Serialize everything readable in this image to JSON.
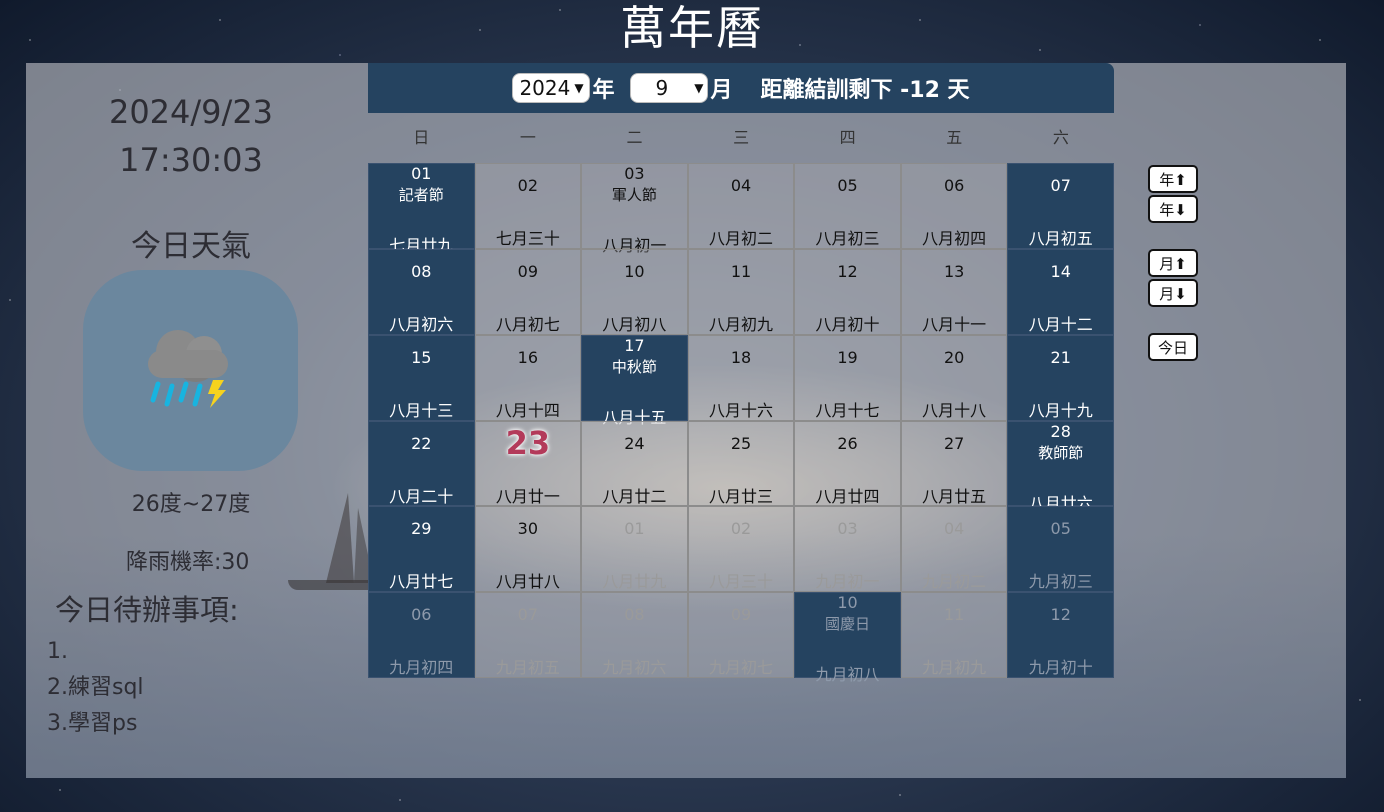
{
  "page_title": "萬年曆",
  "left": {
    "date": "2024/9/23",
    "time": "17:30:03",
    "weather_title": "今日天氣",
    "weather_icon": "thunderstorm-rain-icon",
    "temperature": "26度~27度",
    "rain_chance": "降雨機率:30",
    "todo_title": "今日待辦事項:",
    "todos": [
      "1.",
      "2.練習sql",
      "3.學習ps"
    ]
  },
  "header": {
    "year_value": "2024",
    "year_label": "年",
    "month_value": "9",
    "month_label": "月",
    "countdown": "距離結訓剩下 -12 天"
  },
  "weekdays": [
    "日",
    "一",
    "二",
    "三",
    "四",
    "五",
    "六"
  ],
  "calendar": [
    [
      {
        "day": "01",
        "fest": "記者節",
        "lunar": "七月廿九",
        "type": "weekend"
      },
      {
        "day": "02",
        "lunar": "七月三十",
        "type": "normal"
      },
      {
        "day": "03",
        "fest": "軍人節",
        "lunar": "八月初一",
        "type": "normal"
      },
      {
        "day": "04",
        "lunar": "八月初二",
        "type": "normal"
      },
      {
        "day": "05",
        "lunar": "八月初三",
        "type": "normal"
      },
      {
        "day": "06",
        "lunar": "八月初四",
        "type": "normal"
      },
      {
        "day": "07",
        "lunar": "八月初五",
        "type": "weekend"
      }
    ],
    [
      {
        "day": "08",
        "lunar": "八月初六",
        "type": "weekend"
      },
      {
        "day": "09",
        "lunar": "八月初七",
        "type": "normal"
      },
      {
        "day": "10",
        "lunar": "八月初八",
        "type": "normal"
      },
      {
        "day": "11",
        "lunar": "八月初九",
        "type": "normal"
      },
      {
        "day": "12",
        "lunar": "八月初十",
        "type": "normal"
      },
      {
        "day": "13",
        "lunar": "八月十一",
        "type": "normal"
      },
      {
        "day": "14",
        "lunar": "八月十二",
        "type": "weekend"
      }
    ],
    [
      {
        "day": "15",
        "lunar": "八月十三",
        "type": "weekend"
      },
      {
        "day": "16",
        "lunar": "八月十四",
        "type": "normal"
      },
      {
        "day": "17",
        "fest": "中秋節",
        "lunar": "八月十五",
        "type": "holiday"
      },
      {
        "day": "18",
        "lunar": "八月十六",
        "type": "normal"
      },
      {
        "day": "19",
        "lunar": "八月十七",
        "type": "normal"
      },
      {
        "day": "20",
        "lunar": "八月十八",
        "type": "normal"
      },
      {
        "day": "21",
        "lunar": "八月十九",
        "type": "weekend"
      }
    ],
    [
      {
        "day": "22",
        "lunar": "八月二十",
        "type": "weekend"
      },
      {
        "day": "23",
        "lunar": "八月廿一",
        "type": "today"
      },
      {
        "day": "24",
        "lunar": "八月廿二",
        "type": "normal"
      },
      {
        "day": "25",
        "lunar": "八月廿三",
        "type": "normal"
      },
      {
        "day": "26",
        "lunar": "八月廿四",
        "type": "normal"
      },
      {
        "day": "27",
        "lunar": "八月廿五",
        "type": "normal"
      },
      {
        "day": "28",
        "fest": "教師節",
        "lunar": "八月廿六",
        "type": "weekend"
      }
    ],
    [
      {
        "day": "29",
        "lunar": "八月廿七",
        "type": "weekend"
      },
      {
        "day": "30",
        "lunar": "八月廿八",
        "type": "normal"
      },
      {
        "day": "01",
        "lunar": "八月廿九",
        "type": "other"
      },
      {
        "day": "02",
        "lunar": "八月三十",
        "type": "other"
      },
      {
        "day": "03",
        "lunar": "九月初一",
        "type": "other"
      },
      {
        "day": "04",
        "lunar": "九月初二",
        "type": "other"
      },
      {
        "day": "05",
        "lunar": "九月初三",
        "type": "other weekend"
      }
    ],
    [
      {
        "day": "06",
        "lunar": "九月初四",
        "type": "other weekend"
      },
      {
        "day": "07",
        "lunar": "九月初五",
        "type": "other"
      },
      {
        "day": "08",
        "lunar": "九月初六",
        "type": "other"
      },
      {
        "day": "09",
        "lunar": "九月初七",
        "type": "other"
      },
      {
        "day": "10",
        "fest": "國慶日",
        "lunar": "九月初八",
        "type": "other holiday"
      },
      {
        "day": "11",
        "lunar": "九月初九",
        "type": "other"
      },
      {
        "day": "12",
        "lunar": "九月初十",
        "type": "other weekend"
      }
    ]
  ],
  "buttons": {
    "year_up": "年⬆",
    "year_down": "年⬇",
    "month_up": "月⬆",
    "month_down": "月⬇",
    "today": "今日"
  },
  "colors": {
    "header_bg": "#254360",
    "weekend_bg": "#254360",
    "today_text": "#b33a5a",
    "weather_card": "#6b879e"
  }
}
